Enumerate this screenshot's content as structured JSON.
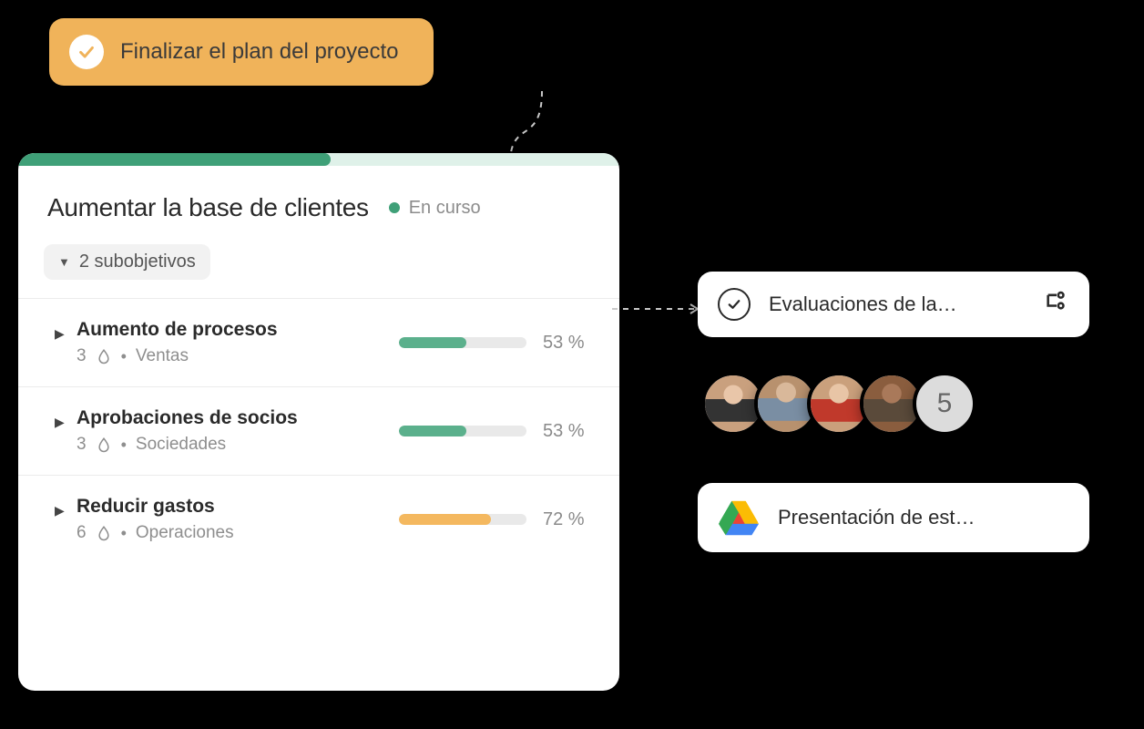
{
  "task": {
    "label": "Finalizar el plan del proyecto"
  },
  "objective": {
    "title": "Aumentar la base de clientes",
    "status_label": "En curso",
    "status_color": "#3fa078",
    "progress_pct": 52,
    "subgoals_toggle_label": "2 subobjetivos",
    "subgoals": [
      {
        "name": "Aumento de procesos",
        "count": "3",
        "team": "Ventas",
        "pct": 53,
        "pct_label": "53 %",
        "bar_color": "green"
      },
      {
        "name": "Aprobaciones de socios",
        "count": "3",
        "team": "Sociedades",
        "pct": 53,
        "pct_label": "53 %",
        "bar_color": "green"
      },
      {
        "name": "Reducir gastos",
        "count": "6",
        "team": "Operaciones",
        "pct": 72,
        "pct_label": "72 %",
        "bar_color": "orange"
      }
    ]
  },
  "side": {
    "evaluation_label": "Evaluaciones de la…",
    "avatars_more_count": "5",
    "doc_label": "Presentación de est…"
  }
}
